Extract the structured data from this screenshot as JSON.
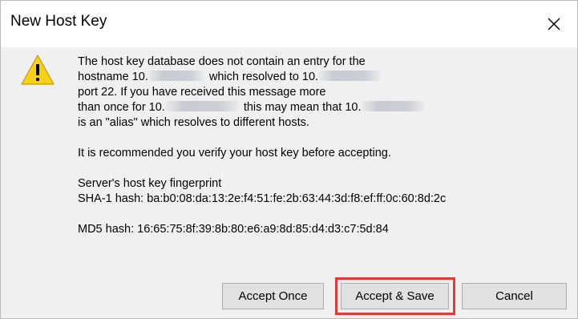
{
  "window": {
    "title": "New Host Key",
    "close_icon": "close-icon"
  },
  "message": {
    "icon": "warning-icon",
    "line1": "The host key database does not contain an entry for the",
    "line2a": "hostname 10.",
    "line2b": "which resolved to 10.",
    "line3": "port 22.  If you have received this message more",
    "line4a": "than once for 10.",
    "line4b": "this may mean that 10.",
    "line5": "is an \"alias\" which resolves to different hosts.",
    "recommendation": "It is recommended you verify your host key before accepting.",
    "fingerprint_heading": "Server's host key fingerprint",
    "sha1": "SHA-1 hash: ba:b0:08:da:13:2e:f4:51:fe:2b:63:44:3d:f8:ef:ff:0c:60:8d:2c",
    "md5": "MD5 hash: 16:65:75:8f:39:8b:80:e6:a9:8d:85:d4:d3:c7:5d:84"
  },
  "buttons": {
    "accept_once": "Accept Once",
    "accept_save": "Accept & Save",
    "cancel": "Cancel"
  },
  "colors": {
    "highlight": "#e03a3a",
    "dialog_background": "#f0f0f0",
    "warning_yellow": "#f7d117"
  }
}
